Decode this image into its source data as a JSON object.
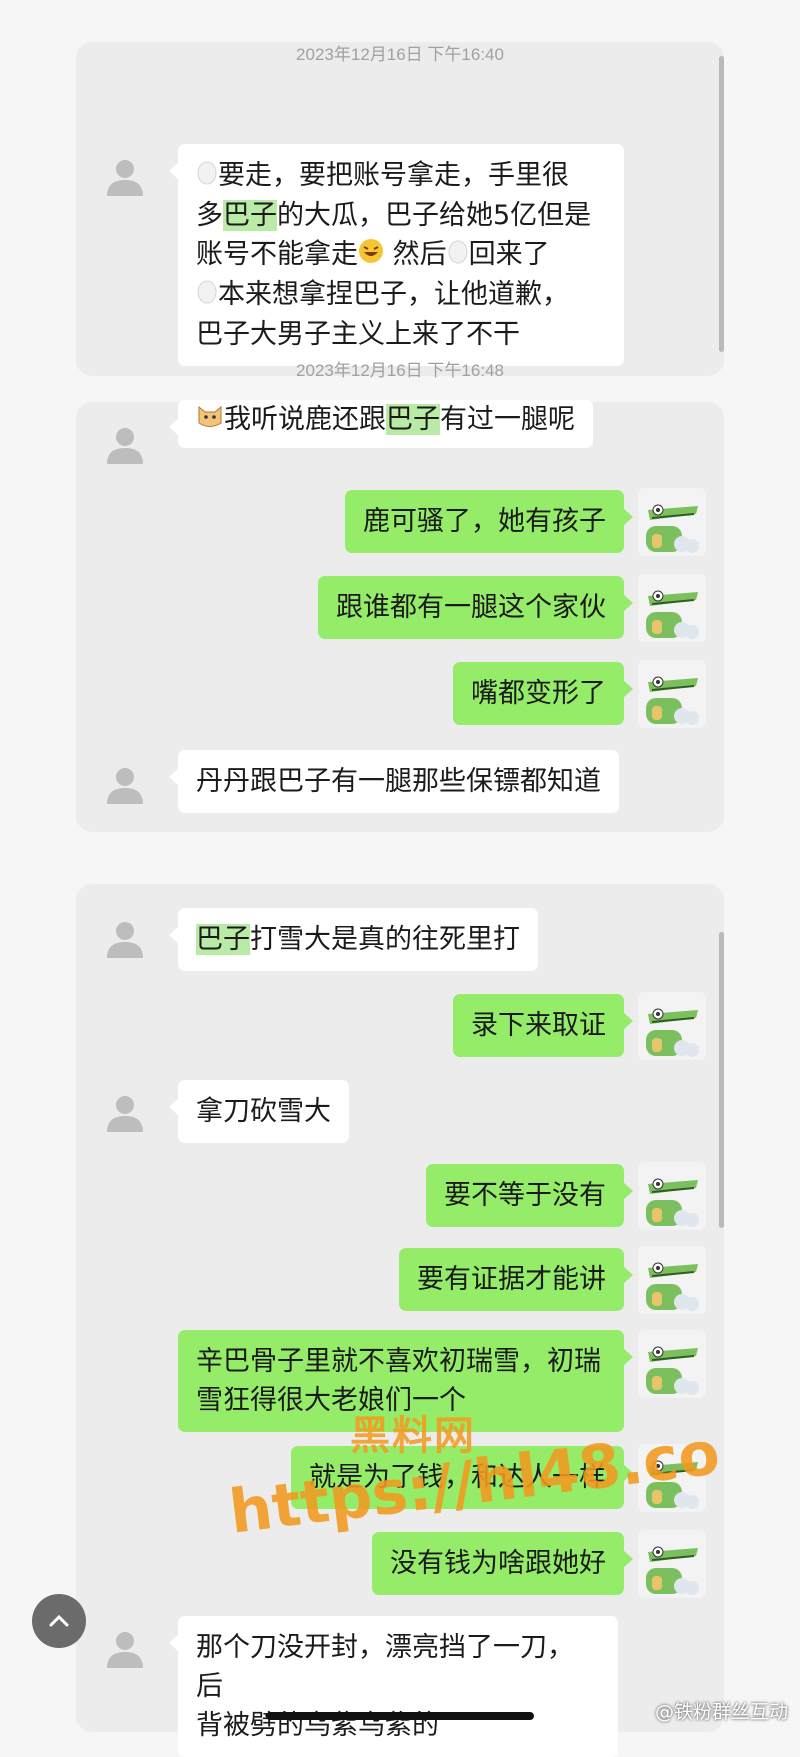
{
  "timestamps": [
    "2023年12月16日 下午16:40",
    "2023年12月16日 下午16:48"
  ],
  "card1": {
    "msg1_lines": [
      "要走，要把账号拿走，手里很",
      "的大瓜，巴子给她5亿但是",
      "账号不能拿走",
      "然后",
      "回来了",
      "本来想拿捏巴子，让他道歉，",
      "巴子大男子主义上来了不干"
    ],
    "line2_prefix": "多",
    "line2_hl": "巴子"
  },
  "card2": {
    "in1_text": "我听说鹿还跟",
    "in1_hl": "巴子",
    "in1_tail": "有过一腿呢",
    "out1": "鹿可骚了，她有孩子",
    "out2": "跟谁都有一腿这个家伙",
    "out3": "嘴都变形了",
    "in2": "丹丹跟巴子有一腿那些保镖都知道"
  },
  "card3": {
    "in1_hl": "巴子",
    "in1_tail": "打雪大是真的往死里打",
    "out1": "录下来取证",
    "in2": "拿刀砍雪大",
    "out2": "要不等于没有",
    "out3": "要有证据才能讲",
    "out4_line1": "辛巴骨子里就不喜欢初瑞雪，初瑞",
    "out4_line2": "雪狂得很大老娘们一个",
    "out5": "就是为了钱，和达人一样",
    "out6": "没有钱为啥跟她好",
    "in3_line1": "那个刀没开封，漂亮挡了一刀，后",
    "in3_line2": "背被劈的乌紫乌紫的"
  },
  "watermark": {
    "cn": "黑料网",
    "url": "https://hl48.co"
  },
  "weibo": "@铁粉群丝互动",
  "icons": {
    "fab": "chevron-up-icon",
    "avatar_left": "person-placeholder-icon",
    "avatar_right": "crocodile-avatar-icon"
  },
  "colors": {
    "bubble_out": "#95ec69",
    "bubble_in": "#ffffff",
    "card": "#ececec",
    "watermark": "#f39a1f"
  }
}
